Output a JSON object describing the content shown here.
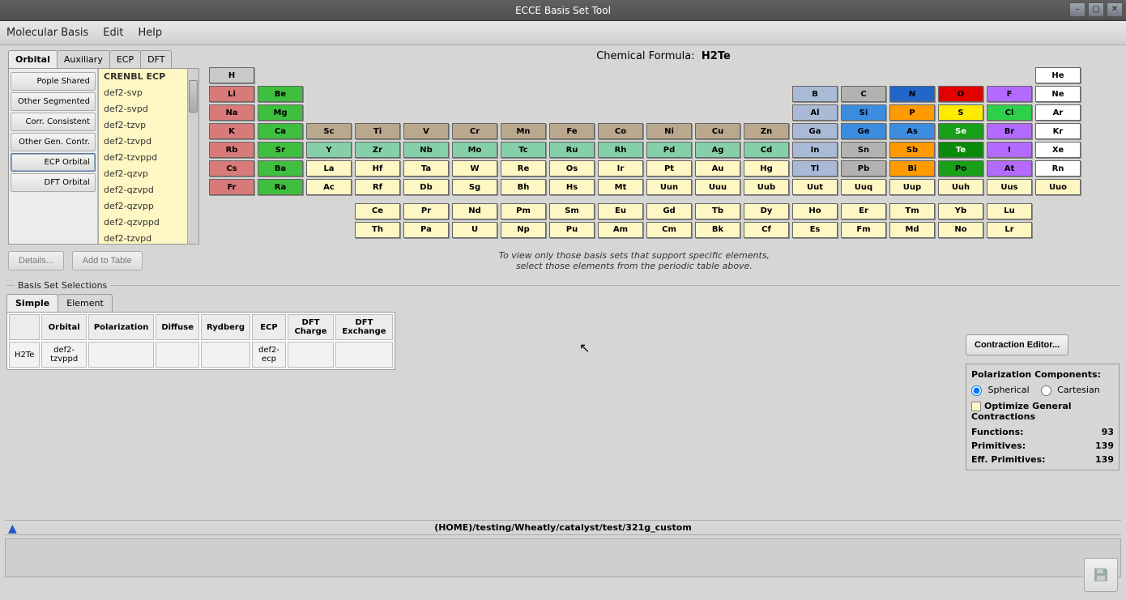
{
  "window": {
    "title": "ECCE Basis Set Tool"
  },
  "menu": {
    "items": [
      "Molecular Basis",
      "Edit",
      "Help"
    ]
  },
  "left_tabs": [
    "Orbital",
    "Auxiliary",
    "ECP",
    "DFT"
  ],
  "left_tabs_active": 0,
  "categories": [
    "Pople Shared",
    "Other Segmented",
    "Corr. Consistent",
    "Other Gen. Contr.",
    "ECP Orbital",
    "DFT Orbital"
  ],
  "categories_selected": 4,
  "basis_list": [
    "CRENBL ECP",
    "def2-svp",
    "def2-svpd",
    "def2-tzvp",
    "def2-tzvpd",
    "def2-tzvppd",
    "def2-qzvp",
    "def2-qzvpd",
    "def2-qzvpp",
    "def2-qzvppd",
    "def2-tzvpd"
  ],
  "basis_selected": 0,
  "details_btn": "Details...",
  "add_btn": "Add to Table",
  "hint_line1": "To view only those basis sets that support specific elements,",
  "hint_line2": "select those elements from the periodic table above.",
  "formula_label": "Chemical Formula:",
  "formula_value": "H2Te",
  "elements": [
    {
      "s": "H",
      "c": 0,
      "r": 0,
      "col": "#c9c9c7"
    },
    {
      "s": "He",
      "c": 17,
      "r": 0,
      "col": "#ffffff"
    },
    {
      "s": "Li",
      "c": 0,
      "r": 1,
      "col": "#d97a7a"
    },
    {
      "s": "Be",
      "c": 1,
      "r": 1,
      "col": "#3fbf3f"
    },
    {
      "s": "B",
      "c": 12,
      "r": 1,
      "col": "#a9b9d6"
    },
    {
      "s": "C",
      "c": 13,
      "r": 1,
      "col": "#b2b2b0"
    },
    {
      "s": "N",
      "c": 14,
      "r": 1,
      "col": "#2166c8"
    },
    {
      "s": "O",
      "c": 15,
      "r": 1,
      "col": "#e30000"
    },
    {
      "s": "F",
      "c": 16,
      "r": 1,
      "col": "#b36bff"
    },
    {
      "s": "Ne",
      "c": 17,
      "r": 1,
      "col": "#ffffff"
    },
    {
      "s": "Na",
      "c": 0,
      "r": 2,
      "col": "#d97a7a"
    },
    {
      "s": "Mg",
      "c": 1,
      "r": 2,
      "col": "#3fbf3f"
    },
    {
      "s": "Al",
      "c": 12,
      "r": 2,
      "col": "#a9b9d6"
    },
    {
      "s": "Si",
      "c": 13,
      "r": 2,
      "col": "#3c8de0"
    },
    {
      "s": "P",
      "c": 14,
      "r": 2,
      "col": "#ff9a00"
    },
    {
      "s": "S",
      "c": 15,
      "r": 2,
      "col": "#ffeb00"
    },
    {
      "s": "Cl",
      "c": 16,
      "r": 2,
      "col": "#2ecf4a"
    },
    {
      "s": "Ar",
      "c": 17,
      "r": 2,
      "col": "#ffffff"
    },
    {
      "s": "K",
      "c": 0,
      "r": 3,
      "col": "#d97a7a"
    },
    {
      "s": "Ca",
      "c": 1,
      "r": 3,
      "col": "#3fbf3f"
    },
    {
      "s": "Sc",
      "c": 2,
      "r": 3,
      "col": "#b9a88e"
    },
    {
      "s": "Ti",
      "c": 3,
      "r": 3,
      "col": "#b9a88e"
    },
    {
      "s": "V",
      "c": 4,
      "r": 3,
      "col": "#b9a88e"
    },
    {
      "s": "Cr",
      "c": 5,
      "r": 3,
      "col": "#b9a88e"
    },
    {
      "s": "Mn",
      "c": 6,
      "r": 3,
      "col": "#b9a88e"
    },
    {
      "s": "Fe",
      "c": 7,
      "r": 3,
      "col": "#b9a88e"
    },
    {
      "s": "Co",
      "c": 8,
      "r": 3,
      "col": "#b9a88e"
    },
    {
      "s": "Ni",
      "c": 9,
      "r": 3,
      "col": "#b9a88e"
    },
    {
      "s": "Cu",
      "c": 10,
      "r": 3,
      "col": "#b9a88e"
    },
    {
      "s": "Zn",
      "c": 11,
      "r": 3,
      "col": "#b9a88e"
    },
    {
      "s": "Ga",
      "c": 12,
      "r": 3,
      "col": "#a9b9d6"
    },
    {
      "s": "Ge",
      "c": 13,
      "r": 3,
      "col": "#3c8de0"
    },
    {
      "s": "As",
      "c": 14,
      "r": 3,
      "col": "#3c8de0"
    },
    {
      "s": "Se",
      "c": 15,
      "r": 3,
      "col": "#18a018"
    },
    {
      "s": "Br",
      "c": 16,
      "r": 3,
      "col": "#b36bff"
    },
    {
      "s": "Kr",
      "c": 17,
      "r": 3,
      "col": "#ffffff"
    },
    {
      "s": "Rb",
      "c": 0,
      "r": 4,
      "col": "#d97a7a"
    },
    {
      "s": "Sr",
      "c": 1,
      "r": 4,
      "col": "#3fbf3f"
    },
    {
      "s": "Y",
      "c": 2,
      "r": 4,
      "col": "#86d0a9"
    },
    {
      "s": "Zr",
      "c": 3,
      "r": 4,
      "col": "#86d0a9"
    },
    {
      "s": "Nb",
      "c": 4,
      "r": 4,
      "col": "#86d0a9"
    },
    {
      "s": "Mo",
      "c": 5,
      "r": 4,
      "col": "#86d0a9"
    },
    {
      "s": "Tc",
      "c": 6,
      "r": 4,
      "col": "#86d0a9"
    },
    {
      "s": "Ru",
      "c": 7,
      "r": 4,
      "col": "#86d0a9"
    },
    {
      "s": "Rh",
      "c": 8,
      "r": 4,
      "col": "#86d0a9"
    },
    {
      "s": "Pd",
      "c": 9,
      "r": 4,
      "col": "#86d0a9"
    },
    {
      "s": "Ag",
      "c": 10,
      "r": 4,
      "col": "#86d0a9"
    },
    {
      "s": "Cd",
      "c": 11,
      "r": 4,
      "col": "#86d0a9"
    },
    {
      "s": "In",
      "c": 12,
      "r": 4,
      "col": "#a9b9d6"
    },
    {
      "s": "Sn",
      "c": 13,
      "r": 4,
      "col": "#b2b2b0"
    },
    {
      "s": "Sb",
      "c": 14,
      "r": 4,
      "col": "#ff9a00"
    },
    {
      "s": "Te",
      "c": 15,
      "r": 4,
      "col": "#0a8a0a"
    },
    {
      "s": "I",
      "c": 16,
      "r": 4,
      "col": "#b36bff"
    },
    {
      "s": "Xe",
      "c": 17,
      "r": 4,
      "col": "#ffffff"
    },
    {
      "s": "Cs",
      "c": 0,
      "r": 5,
      "col": "#d97a7a"
    },
    {
      "s": "Ba",
      "c": 1,
      "r": 5,
      "col": "#3fbf3f"
    },
    {
      "s": "La",
      "c": 2,
      "r": 5,
      "col": "#fef6c3"
    },
    {
      "s": "Hf",
      "c": 3,
      "r": 5,
      "col": "#fef6c3"
    },
    {
      "s": "Ta",
      "c": 4,
      "r": 5,
      "col": "#fef6c3"
    },
    {
      "s": "W",
      "c": 5,
      "r": 5,
      "col": "#fef6c3"
    },
    {
      "s": "Re",
      "c": 6,
      "r": 5,
      "col": "#fef6c3"
    },
    {
      "s": "Os",
      "c": 7,
      "r": 5,
      "col": "#fef6c3"
    },
    {
      "s": "Ir",
      "c": 8,
      "r": 5,
      "col": "#fef6c3"
    },
    {
      "s": "Pt",
      "c": 9,
      "r": 5,
      "col": "#fef6c3"
    },
    {
      "s": "Au",
      "c": 10,
      "r": 5,
      "col": "#fef6c3"
    },
    {
      "s": "Hg",
      "c": 11,
      "r": 5,
      "col": "#fef6c3"
    },
    {
      "s": "Tl",
      "c": 12,
      "r": 5,
      "col": "#a9b9d6"
    },
    {
      "s": "Pb",
      "c": 13,
      "r": 5,
      "col": "#b2b2b0"
    },
    {
      "s": "Bi",
      "c": 14,
      "r": 5,
      "col": "#ff9a00"
    },
    {
      "s": "Po",
      "c": 15,
      "r": 5,
      "col": "#18a018"
    },
    {
      "s": "At",
      "c": 16,
      "r": 5,
      "col": "#b36bff"
    },
    {
      "s": "Rn",
      "c": 17,
      "r": 5,
      "col": "#ffffff"
    },
    {
      "s": "Fr",
      "c": 0,
      "r": 6,
      "col": "#d97a7a"
    },
    {
      "s": "Ra",
      "c": 1,
      "r": 6,
      "col": "#3fbf3f"
    },
    {
      "s": "Ac",
      "c": 2,
      "r": 6,
      "col": "#fef6c3"
    },
    {
      "s": "Rf",
      "c": 3,
      "r": 6,
      "col": "#fef6c3"
    },
    {
      "s": "Db",
      "c": 4,
      "r": 6,
      "col": "#fef6c3"
    },
    {
      "s": "Sg",
      "c": 5,
      "r": 6,
      "col": "#fef6c3"
    },
    {
      "s": "Bh",
      "c": 6,
      "r": 6,
      "col": "#fef6c3"
    },
    {
      "s": "Hs",
      "c": 7,
      "r": 6,
      "col": "#fef6c3"
    },
    {
      "s": "Mt",
      "c": 8,
      "r": 6,
      "col": "#fef6c3"
    },
    {
      "s": "Uun",
      "c": 9,
      "r": 6,
      "col": "#fef6c3"
    },
    {
      "s": "Uuu",
      "c": 10,
      "r": 6,
      "col": "#fef6c3"
    },
    {
      "s": "Uub",
      "c": 11,
      "r": 6,
      "col": "#fef6c3"
    },
    {
      "s": "Uut",
      "c": 12,
      "r": 6,
      "col": "#fef6c3"
    },
    {
      "s": "Uuq",
      "c": 13,
      "r": 6,
      "col": "#fef6c3"
    },
    {
      "s": "Uup",
      "c": 14,
      "r": 6,
      "col": "#fef6c3"
    },
    {
      "s": "Uuh",
      "c": 15,
      "r": 6,
      "col": "#fef6c3"
    },
    {
      "s": "Uus",
      "c": 16,
      "r": 6,
      "col": "#fef6c3"
    },
    {
      "s": "Uuo",
      "c": 17,
      "r": 6,
      "col": "#fef6c3"
    }
  ],
  "lanth": [
    "Ce",
    "Pr",
    "Nd",
    "Pm",
    "Sm",
    "Eu",
    "Gd",
    "Tb",
    "Dy",
    "Ho",
    "Er",
    "Tm",
    "Yb",
    "Lu"
  ],
  "act": [
    "Th",
    "Pa",
    "U",
    "Np",
    "Pu",
    "Am",
    "Cm",
    "Bk",
    "Cf",
    "Es",
    "Fm",
    "Md",
    "No",
    "Lr"
  ],
  "sel_group_title": "Basis Set Selections",
  "sel_tabs": [
    "Simple",
    "Element"
  ],
  "sel_tabs_active": 0,
  "sel_headers": [
    "",
    "Orbital",
    "Polarization",
    "Diffuse",
    "Rydberg",
    "ECP",
    "DFT Charge",
    "DFT Exchange"
  ],
  "sel_row": [
    "H2Te",
    "def2-tzvppd",
    "",
    "",
    "",
    "def2-ecp",
    "",
    ""
  ],
  "contr_btn": "Contraction Editor...",
  "pol_title": "Polarization Components:",
  "pol_radio": [
    "Spherical",
    "Cartesian"
  ],
  "pol_radio_sel": 0,
  "optimize_label": "Optimize General Contractions",
  "stats": {
    "functions_label": "Functions:",
    "functions_val": "93",
    "primitives_label": "Primitives:",
    "primitives_val": "139",
    "eff_label": "Eff. Primitives:",
    "eff_val": "139"
  },
  "path": "(HOME)/testing/Wheatly/catalyst/test/321g_custom"
}
